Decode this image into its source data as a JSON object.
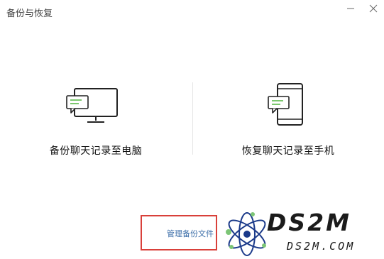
{
  "window": {
    "title": "备份与恢复"
  },
  "options": {
    "backup_to_pc": {
      "label": "备份聊天记录至电脑",
      "icon": "monitor-chat-icon"
    },
    "restore_to_phone": {
      "label": "恢复聊天记录至手机",
      "icon": "phone-chat-icon"
    }
  },
  "manage": {
    "label": "管理备份文件"
  },
  "watermark": {
    "main": "DS2M",
    "sub": "DS2M.COM"
  },
  "colors": {
    "accent_green": "#5cbb4b",
    "highlight_red": "#d9403a",
    "link_blue": "#3b6da8"
  }
}
